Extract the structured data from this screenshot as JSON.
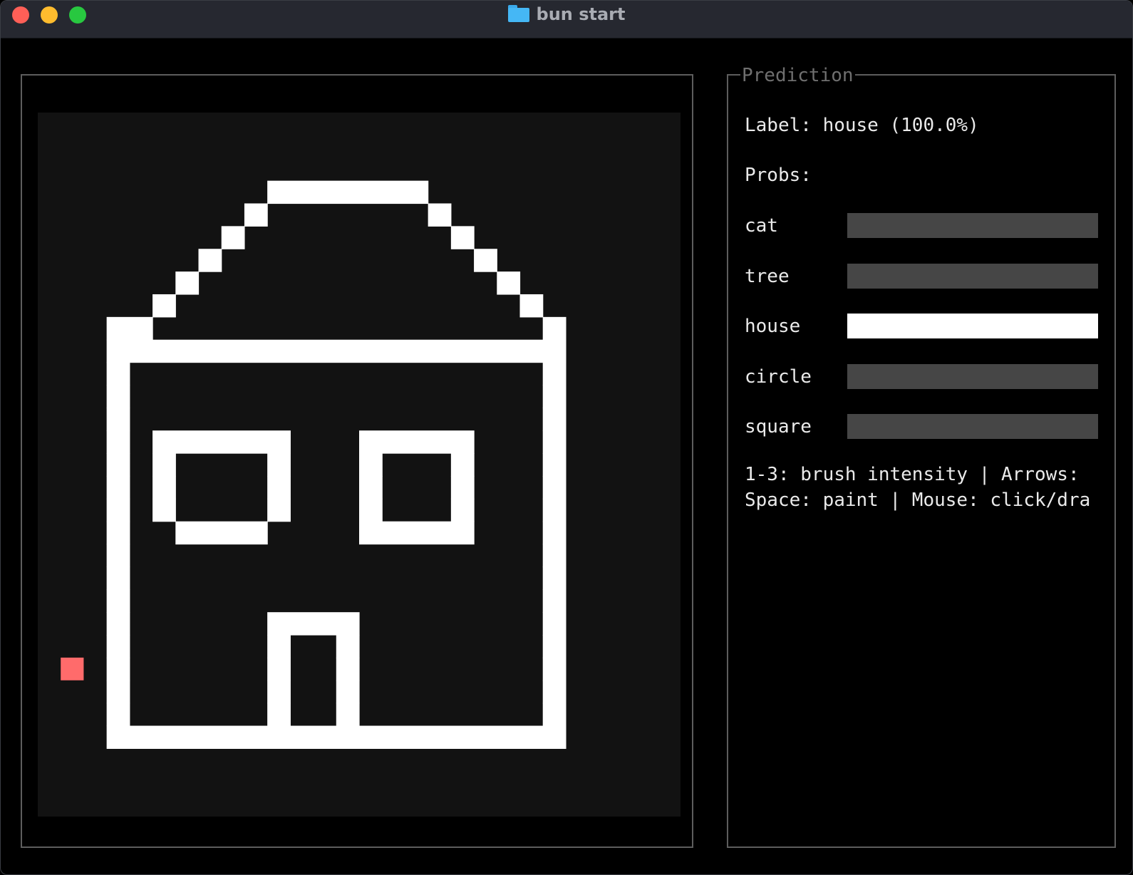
{
  "window": {
    "title": "bun start",
    "title_icon": "folder-icon"
  },
  "colors": {
    "canvas_bg": "#121212",
    "pixel_on": "#ffffff",
    "cursor": "#ff6b6b",
    "bar_track": "#464646",
    "bar_fill": "#ffffff",
    "border": "#5d5d5d"
  },
  "prediction": {
    "legend": "Prediction",
    "label_line": "Label: house (100.0%)",
    "probs_heading": "Probs:",
    "probs": [
      {
        "name": "cat",
        "value": 0.0
      },
      {
        "name": "tree",
        "value": 0.0
      },
      {
        "name": "house",
        "value": 1.0
      },
      {
        "name": "circle",
        "value": 0.0
      },
      {
        "name": "square",
        "value": 0.0
      }
    ],
    "help_line_1": "1-3: brush intensity | Arrows:",
    "help_line_2": "Space: paint | Mouse: click/dra"
  },
  "canvas": {
    "grid_cols": 28,
    "grid_rows": 31,
    "cursor_cell": [
      1,
      24
    ],
    "filled_rows": [
      {
        "row": 3,
        "ranges": [
          [
            10,
            16
          ]
        ]
      },
      {
        "row": 4,
        "ranges": [
          [
            9,
            9
          ],
          [
            17,
            17
          ]
        ]
      },
      {
        "row": 5,
        "ranges": [
          [
            8,
            8
          ],
          [
            18,
            18
          ]
        ]
      },
      {
        "row": 6,
        "ranges": [
          [
            7,
            7
          ],
          [
            19,
            19
          ]
        ]
      },
      {
        "row": 7,
        "ranges": [
          [
            6,
            6
          ],
          [
            20,
            20
          ]
        ]
      },
      {
        "row": 8,
        "ranges": [
          [
            5,
            5
          ],
          [
            21,
            21
          ]
        ]
      },
      {
        "row": 9,
        "ranges": [
          [
            3,
            4
          ],
          [
            22,
            22
          ]
        ]
      },
      {
        "row": 10,
        "ranges": [
          [
            3,
            22
          ]
        ]
      },
      {
        "row": 11,
        "ranges": [
          [
            3,
            3
          ],
          [
            22,
            22
          ]
        ]
      },
      {
        "row": 12,
        "ranges": [
          [
            3,
            3
          ],
          [
            22,
            22
          ]
        ]
      },
      {
        "row": 13,
        "ranges": [
          [
            3,
            3
          ],
          [
            22,
            22
          ]
        ]
      },
      {
        "row": 14,
        "ranges": [
          [
            3,
            3
          ],
          [
            5,
            10
          ],
          [
            14,
            18
          ],
          [
            22,
            22
          ]
        ]
      },
      {
        "row": 15,
        "ranges": [
          [
            3,
            3
          ],
          [
            5,
            5
          ],
          [
            10,
            10
          ],
          [
            14,
            14
          ],
          [
            18,
            18
          ],
          [
            22,
            22
          ]
        ]
      },
      {
        "row": 16,
        "ranges": [
          [
            3,
            3
          ],
          [
            5,
            5
          ],
          [
            10,
            10
          ],
          [
            14,
            14
          ],
          [
            18,
            18
          ],
          [
            22,
            22
          ]
        ]
      },
      {
        "row": 17,
        "ranges": [
          [
            3,
            3
          ],
          [
            5,
            5
          ],
          [
            10,
            10
          ],
          [
            14,
            14
          ],
          [
            18,
            18
          ],
          [
            22,
            22
          ]
        ]
      },
      {
        "row": 18,
        "ranges": [
          [
            3,
            3
          ],
          [
            6,
            9
          ],
          [
            14,
            18
          ],
          [
            22,
            22
          ]
        ]
      },
      {
        "row": 19,
        "ranges": [
          [
            3,
            3
          ],
          [
            22,
            22
          ]
        ]
      },
      {
        "row": 20,
        "ranges": [
          [
            3,
            3
          ],
          [
            22,
            22
          ]
        ]
      },
      {
        "row": 21,
        "ranges": [
          [
            3,
            3
          ],
          [
            22,
            22
          ]
        ]
      },
      {
        "row": 22,
        "ranges": [
          [
            3,
            3
          ],
          [
            10,
            13
          ],
          [
            22,
            22
          ]
        ]
      },
      {
        "row": 23,
        "ranges": [
          [
            3,
            3
          ],
          [
            10,
            10
          ],
          [
            13,
            13
          ],
          [
            22,
            22
          ]
        ]
      },
      {
        "row": 24,
        "ranges": [
          [
            3,
            3
          ],
          [
            10,
            10
          ],
          [
            13,
            13
          ],
          [
            22,
            22
          ]
        ]
      },
      {
        "row": 25,
        "ranges": [
          [
            3,
            3
          ],
          [
            10,
            10
          ],
          [
            13,
            13
          ],
          [
            22,
            22
          ]
        ]
      },
      {
        "row": 26,
        "ranges": [
          [
            3,
            3
          ],
          [
            10,
            10
          ],
          [
            13,
            13
          ],
          [
            22,
            22
          ]
        ]
      },
      {
        "row": 27,
        "ranges": [
          [
            3,
            22
          ]
        ]
      }
    ]
  }
}
